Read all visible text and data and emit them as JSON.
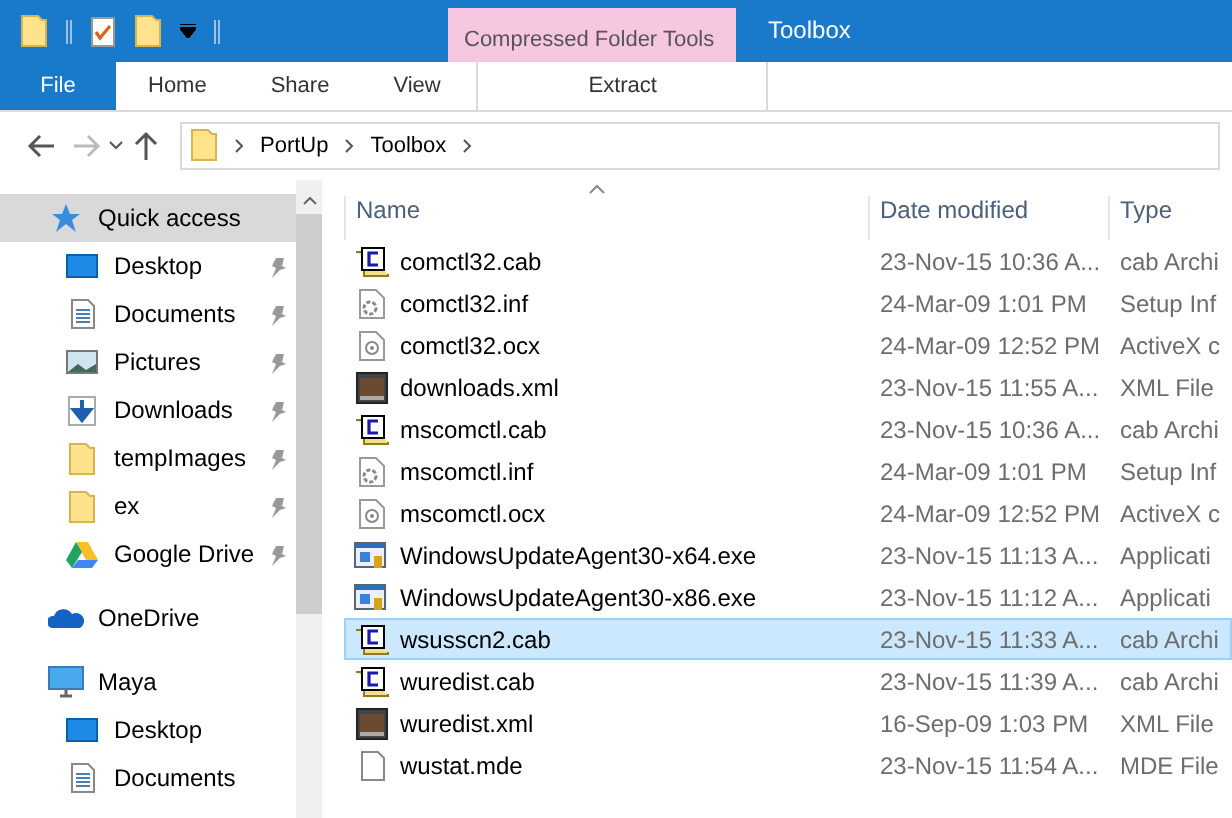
{
  "window": {
    "title": "Toolbox",
    "context_tab": "Compressed Folder Tools"
  },
  "ribbon_tabs": [
    {
      "label": "File",
      "kind": "file"
    },
    {
      "label": "Home",
      "kind": "tab"
    },
    {
      "label": "Share",
      "kind": "tab"
    },
    {
      "label": "View",
      "kind": "tab"
    },
    {
      "label": "Extract",
      "kind": "context"
    }
  ],
  "nav": {
    "back_disabled": false,
    "forward_disabled": true
  },
  "address": {
    "path": [
      "PortUp",
      "Toolbox"
    ]
  },
  "sidebar": {
    "items": [
      {
        "label": "Quick access",
        "kind": "star",
        "selected": true,
        "pinned": false,
        "children": [
          {
            "label": "Desktop",
            "kind": "desktop",
            "selected": false,
            "pinned": true
          },
          {
            "label": "Documents",
            "kind": "documents",
            "selected": false,
            "pinned": true
          },
          {
            "label": "Pictures",
            "kind": "pictures",
            "selected": false,
            "pinned": true
          },
          {
            "label": "Downloads",
            "kind": "downloads",
            "selected": false,
            "pinned": true
          },
          {
            "label": "tempImages",
            "kind": "folder",
            "selected": false,
            "pinned": true
          },
          {
            "label": "ex",
            "kind": "folder",
            "selected": false,
            "pinned": true
          },
          {
            "label": "Google Drive",
            "kind": "gdrive",
            "selected": false,
            "pinned": true
          }
        ]
      },
      {
        "label": "OneDrive",
        "kind": "cloud",
        "selected": false,
        "pinned": false
      },
      {
        "label": "Maya",
        "kind": "pc",
        "selected": false,
        "pinned": false,
        "children": [
          {
            "label": "Desktop",
            "kind": "desktop",
            "selected": false,
            "pinned": false
          },
          {
            "label": "Documents",
            "kind": "documents",
            "selected": false,
            "pinned": false
          }
        ]
      }
    ]
  },
  "table": {
    "columns": [
      "Name",
      "Date modified",
      "Type"
    ],
    "rows": [
      {
        "kind": "cab",
        "name": "comctl32.cab",
        "date": "23-Nov-15 10:36 A...",
        "type": "cab Archi",
        "selected": false
      },
      {
        "kind": "inf",
        "name": "comctl32.inf",
        "date": "24-Mar-09 1:01 PM",
        "type": "Setup Inf",
        "selected": false
      },
      {
        "kind": "ocx",
        "name": "comctl32.ocx",
        "date": "24-Mar-09 12:52 PM",
        "type": "ActiveX c",
        "selected": false
      },
      {
        "kind": "xml",
        "name": "downloads.xml",
        "date": "23-Nov-15 11:55 A...",
        "type": "XML File",
        "selected": false
      },
      {
        "kind": "cab",
        "name": "mscomctl.cab",
        "date": "23-Nov-15 10:36 A...",
        "type": "cab Archi",
        "selected": false
      },
      {
        "kind": "inf",
        "name": "mscomctl.inf",
        "date": "24-Mar-09 1:01 PM",
        "type": "Setup Inf",
        "selected": false
      },
      {
        "kind": "ocx",
        "name": "mscomctl.ocx",
        "date": "24-Mar-09 12:52 PM",
        "type": "ActiveX c",
        "selected": false
      },
      {
        "kind": "exe",
        "name": "WindowsUpdateAgent30-x64.exe",
        "date": "23-Nov-15 11:13 A...",
        "type": "Applicati",
        "selected": false
      },
      {
        "kind": "exe",
        "name": "WindowsUpdateAgent30-x86.exe",
        "date": "23-Nov-15 11:12 A...",
        "type": "Applicati",
        "selected": false
      },
      {
        "kind": "cab",
        "name": "wsusscn2.cab",
        "date": "23-Nov-15 11:33 A...",
        "type": "cab Archi",
        "selected": true
      },
      {
        "kind": "cab",
        "name": "wuredist.cab",
        "date": "23-Nov-15 11:39 A...",
        "type": "cab Archi",
        "selected": false
      },
      {
        "kind": "xml",
        "name": "wuredist.xml",
        "date": "16-Sep-09 1:03 PM",
        "type": "XML File",
        "selected": false
      },
      {
        "kind": "mde",
        "name": "wustat.mde",
        "date": "23-Nov-15 11:54 A...",
        "type": "MDE File",
        "selected": false
      }
    ]
  }
}
